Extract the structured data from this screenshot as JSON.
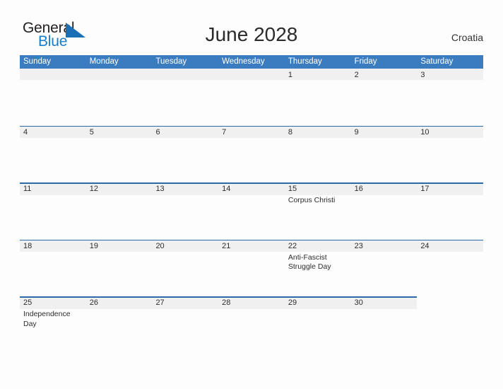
{
  "brand": {
    "name_part1": "General",
    "name_part2": "Blue",
    "accent_color": "#1a7dc4",
    "triangle_icon": "triangle-icon"
  },
  "header": {
    "title": "June 2028",
    "country": "Croatia"
  },
  "calendar": {
    "header_bg": "#3b7cc0",
    "band_bg": "#f0f0f0",
    "rule_color": "#2a6aa8",
    "day_names": [
      "Sunday",
      "Monday",
      "Tuesday",
      "Wednesday",
      "Thursday",
      "Friday",
      "Saturday"
    ],
    "weeks": [
      {
        "days": [
          {
            "num": "",
            "event": ""
          },
          {
            "num": "",
            "event": ""
          },
          {
            "num": "",
            "event": ""
          },
          {
            "num": "",
            "event": ""
          },
          {
            "num": "1",
            "event": ""
          },
          {
            "num": "2",
            "event": ""
          },
          {
            "num": "3",
            "event": ""
          }
        ]
      },
      {
        "days": [
          {
            "num": "4",
            "event": ""
          },
          {
            "num": "5",
            "event": ""
          },
          {
            "num": "6",
            "event": ""
          },
          {
            "num": "7",
            "event": ""
          },
          {
            "num": "8",
            "event": ""
          },
          {
            "num": "9",
            "event": ""
          },
          {
            "num": "10",
            "event": ""
          }
        ]
      },
      {
        "days": [
          {
            "num": "11",
            "event": ""
          },
          {
            "num": "12",
            "event": ""
          },
          {
            "num": "13",
            "event": ""
          },
          {
            "num": "14",
            "event": ""
          },
          {
            "num": "15",
            "event": "Corpus Christi"
          },
          {
            "num": "16",
            "event": ""
          },
          {
            "num": "17",
            "event": ""
          }
        ]
      },
      {
        "days": [
          {
            "num": "18",
            "event": ""
          },
          {
            "num": "19",
            "event": ""
          },
          {
            "num": "20",
            "event": ""
          },
          {
            "num": "21",
            "event": ""
          },
          {
            "num": "22",
            "event": "Anti-Fascist Struggle Day"
          },
          {
            "num": "23",
            "event": ""
          },
          {
            "num": "24",
            "event": ""
          }
        ]
      },
      {
        "days": [
          {
            "num": "25",
            "event": "Independence Day"
          },
          {
            "num": "26",
            "event": ""
          },
          {
            "num": "27",
            "event": ""
          },
          {
            "num": "28",
            "event": ""
          },
          {
            "num": "29",
            "event": ""
          },
          {
            "num": "30",
            "event": ""
          },
          {
            "num": "",
            "event": ""
          }
        ]
      }
    ]
  }
}
